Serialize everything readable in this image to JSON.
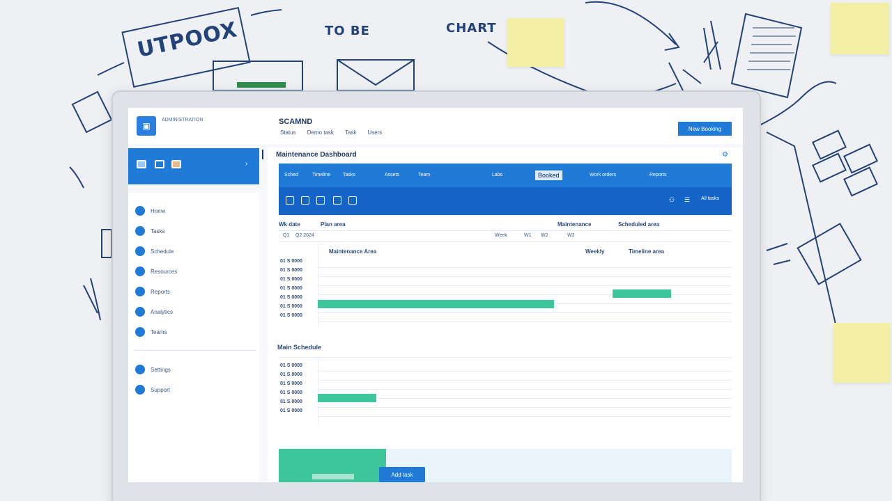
{
  "background": {
    "sketch_texts": [
      "UTPOOX",
      "TO BE",
      "CHART"
    ],
    "colors": {
      "ink": "#22427a",
      "sticky": "#f3f0a6",
      "board": "#eef0f3"
    }
  },
  "topbar": {
    "logo_icon": "app-logo-icon",
    "logo_text": "ADMINISTRATION",
    "app_title": "SCAMND",
    "nav": [
      "Status",
      "Demo task",
      "Task",
      "Users"
    ],
    "action_button": "New Booking"
  },
  "sidebar": {
    "header_icons": [
      "grid-icon",
      "calendar-icon",
      "tag-icon"
    ],
    "toggle_icon": "chevron-icon",
    "items": [
      "Home",
      "Tasks",
      "Schedule",
      "Resources",
      "Reports",
      "Analytics",
      "Teams"
    ],
    "footer_items": [
      "Settings",
      "Support"
    ]
  },
  "main": {
    "title": "Maintenance Dashboard",
    "tabs": [
      "Sched",
      "Timeline",
      "Tasks",
      "Assets",
      "Team",
      "Labs",
      "Booked",
      "Work orders",
      "Reports"
    ],
    "active_tab": "Booked",
    "toolbar_right": "All tasks",
    "columns": {
      "left_a": "Wk date",
      "left_b": "Plan area",
      "right_a": "Maintenance",
      "right_b": "Scheduled area"
    },
    "sub_headers": {
      "left": "Q1",
      "left2": "Q2 2024",
      "mid": "Week",
      "mid2": "W1",
      "mid3": "W2",
      "right": "W3"
    },
    "section1": {
      "label": "Maintenance Area",
      "right_a": "Weekly",
      "right_b": "Timeline area"
    },
    "section1_rows": [
      "01 S 0000",
      "01 S 0000",
      "01 S 0000",
      "01 S 0000",
      "01 S 0000",
      "01 S 0000",
      "01 S 0000"
    ],
    "section2": {
      "label": "Main Schedule"
    },
    "section2_rows": [
      "01 S 0000",
      "01 S 0000",
      "01 S 0000",
      "01 S 0000",
      "01 S 0000",
      "01 S 0000"
    ],
    "bottom_button": "Add task",
    "accent": "#1f7ad8",
    "bar_color": "#3fc59a"
  }
}
